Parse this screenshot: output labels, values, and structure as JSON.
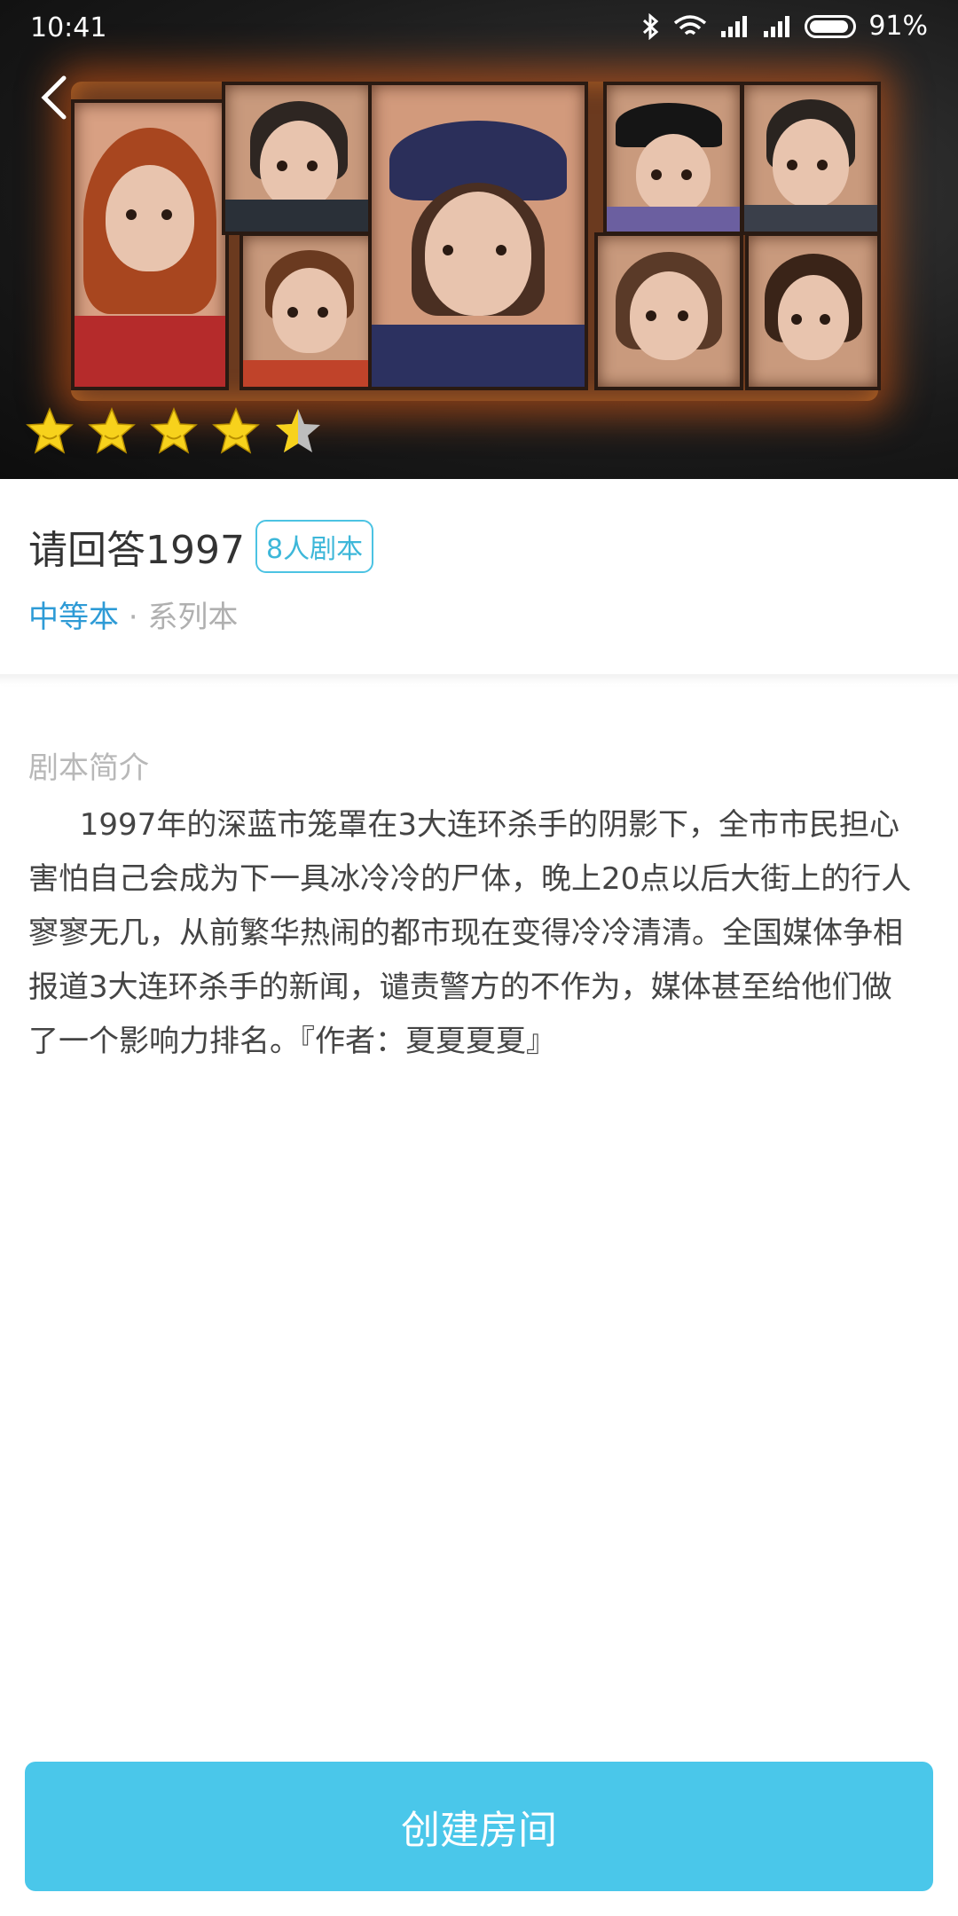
{
  "status_bar": {
    "time": "10:41",
    "battery": "91%"
  },
  "hero": {
    "rating": 4.5,
    "rating_max": 5
  },
  "script": {
    "title": "请回答1997",
    "badge": "8人剧本",
    "level": "中等本",
    "separator": " · ",
    "series": "系列本"
  },
  "intro": {
    "heading": "剧本简介",
    "text": "1997年的深蓝市笼罩在3大连环杀手的阴影下，全市市民担心害怕自己会成为下一具冰冷冷的尸体，晚上20点以后大街上的行人寥寥无几，从前繁华热闹的都市现在变得冷冷清清。全国媒体争相报道3大连环杀手的新闻，谴责警方的不作为，媒体甚至给他们做了一个影响力排名。『作者：夏夏夏夏』"
  },
  "actions": {
    "create_room": "创建房间"
  },
  "colors": {
    "accent": "#4ac7ea",
    "level": "#2e9bd6",
    "star": "#f7d21c"
  }
}
